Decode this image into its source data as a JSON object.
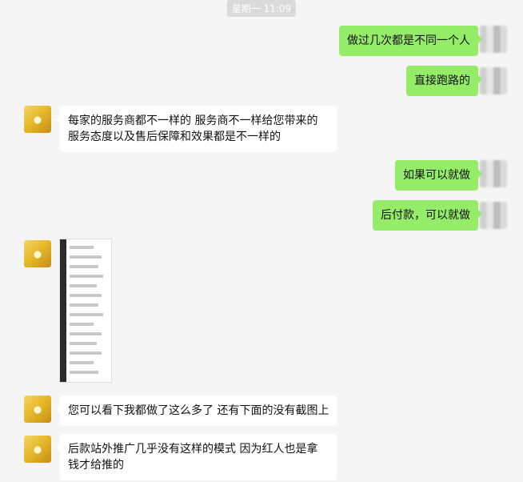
{
  "timestamp": "星期一 11:09",
  "messages": [
    {
      "side": "right",
      "text": "做过几次都是不同一个人"
    },
    {
      "side": "right",
      "text": "直接跑路的"
    },
    {
      "side": "left",
      "text": "每家的服务商都不一样的 服务商不一样给您带来的服务态度以及售后保障和效果都是不一样的"
    },
    {
      "side": "right",
      "text": "如果可以就做"
    },
    {
      "side": "right",
      "text": "后付款，可以就做"
    },
    {
      "side": "left",
      "type": "image"
    },
    {
      "side": "left",
      "text": "您可以看下我都做了这么多了 还有下面的没有截图上"
    },
    {
      "side": "left",
      "text": "后款站外推广几乎没有这样的模式  因为红人也是拿钱才给推的"
    }
  ],
  "colors": {
    "self_bubble": "#95ec69",
    "other_bubble": "#ffffff",
    "background": "#f5f5f5"
  }
}
